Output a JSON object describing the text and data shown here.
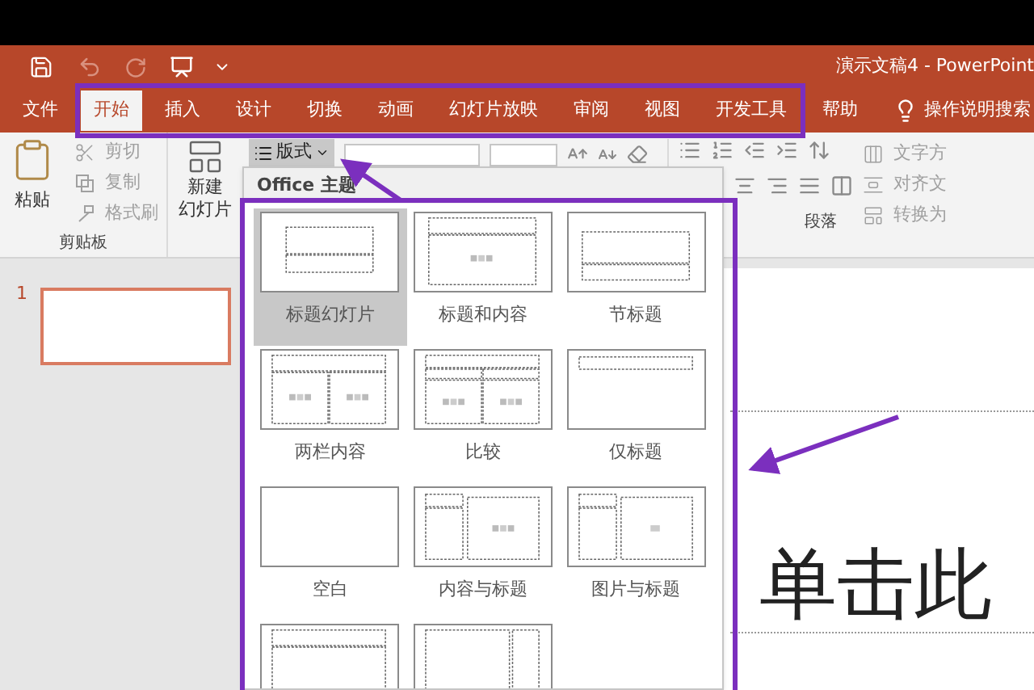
{
  "window": {
    "title": "演示文稿4 - PowerPoint"
  },
  "tabs": [
    {
      "label": "文件",
      "selected": false
    },
    {
      "label": "开始",
      "selected": true
    },
    {
      "label": "插入",
      "selected": false
    },
    {
      "label": "设计",
      "selected": false
    },
    {
      "label": "切换",
      "selected": false
    },
    {
      "label": "动画",
      "selected": false
    },
    {
      "label": "幻灯片放映",
      "selected": false
    },
    {
      "label": "审阅",
      "selected": false
    },
    {
      "label": "视图",
      "selected": false
    },
    {
      "label": "开发工具",
      "selected": false
    },
    {
      "label": "帮助",
      "selected": false
    }
  ],
  "tell_me": "操作说明搜索",
  "ribbon": {
    "clipboard": {
      "paste": "粘贴",
      "tools": [
        {
          "kind": "cut",
          "label": "剪切",
          "disabled": true
        },
        {
          "kind": "copy",
          "label": "复制",
          "disabled": true
        },
        {
          "kind": "brush",
          "label": "格式刷",
          "disabled": true
        }
      ],
      "label": "剪贴板"
    },
    "new_slide": {
      "line1": "新建",
      "line2": "幻灯片"
    },
    "layout_button": {
      "label": "版式",
      "expanded": true
    },
    "paragraph": {
      "tools": [
        {
          "kind": "direction",
          "label": "文字方",
          "disabled": true
        },
        {
          "kind": "align",
          "label": "对齐文",
          "disabled": true
        },
        {
          "kind": "convert",
          "label": "转换为",
          "disabled": true
        }
      ],
      "label": "段落"
    }
  },
  "slides_pane": [
    {
      "number": "1",
      "selected": true
    }
  ],
  "slide": {
    "title_placeholder": "单击此"
  },
  "layout_gallery": {
    "header": "Office 主题",
    "layouts": [
      {
        "kind": "title",
        "label": "标题幻灯片",
        "selected": true
      },
      {
        "kind": "title-content",
        "label": "标题和内容",
        "selected": false
      },
      {
        "kind": "section",
        "label": "节标题",
        "selected": false
      },
      {
        "kind": "two-content",
        "label": "两栏内容",
        "selected": false
      },
      {
        "kind": "comparison",
        "label": "比较",
        "selected": false
      },
      {
        "kind": "title-only",
        "label": "仅标题",
        "selected": false
      },
      {
        "kind": "blank",
        "label": "空白",
        "selected": false
      },
      {
        "kind": "content-caption",
        "label": "内容与标题",
        "selected": false
      },
      {
        "kind": "picture-caption",
        "label": "图片与标题",
        "selected": false
      },
      {
        "kind": "vertical-text",
        "selected": false
      },
      {
        "kind": "vertical-title",
        "selected": false
      }
    ]
  }
}
